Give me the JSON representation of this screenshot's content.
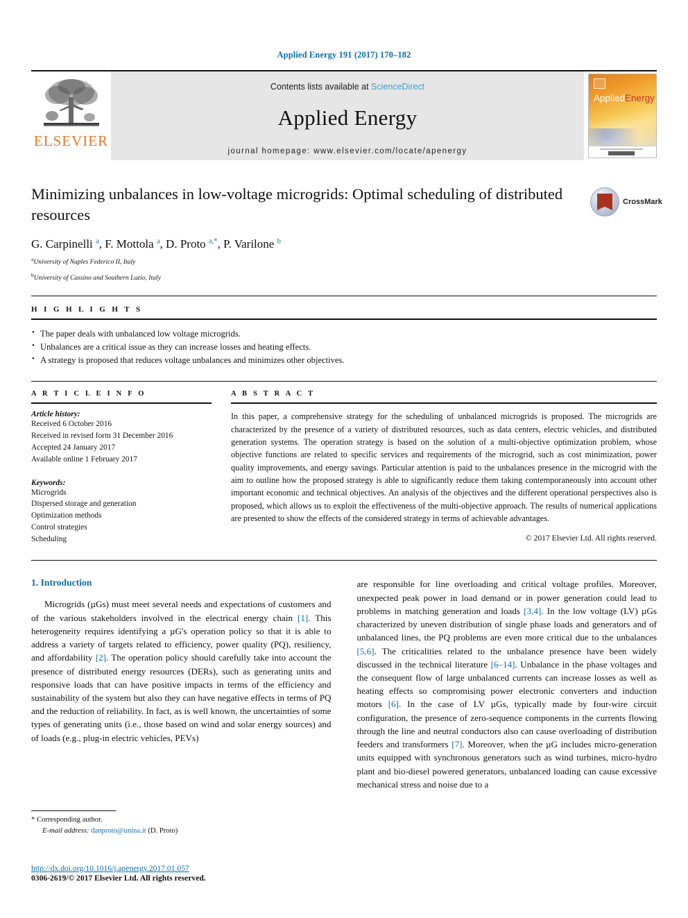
{
  "running_head": "Applied Energy 191 (2017) 170–182",
  "masthead": {
    "publisher_logo_text": "ELSEVIER",
    "contents_prefix": "Contents lists available at ",
    "contents_link": "ScienceDirect",
    "journal_name": "Applied Energy",
    "homepage": "journal homepage: www.elsevier.com/locate/apenergy",
    "cover": {
      "word1": "Applied",
      "word2": "Energy"
    }
  },
  "crossmark": {
    "label": "CrossMark"
  },
  "article": {
    "title": "Minimizing unbalances in low-voltage microgrids: Optimal scheduling of distributed resources",
    "authors_html": "G. Carpinelli <sup>a</sup>, F. Mottola <sup>a</sup>, D. Proto <sup>a,*</sup>, P. Varilone <sup>b</sup>",
    "affiliations": [
      {
        "marker": "a",
        "text": "University of Naples Federico II, Italy"
      },
      {
        "marker": "b",
        "text": "University of Cassino and Southern Lazio, Italy"
      }
    ]
  },
  "highlights": {
    "heading": "H I G H L I G H T S",
    "items": [
      "The paper deals with unbalanced low voltage microgrids.",
      "Unbalances are a critical issue as they can increase losses and heating effects.",
      "A strategy is proposed that reduces voltage unbalances and minimizes other objectives."
    ]
  },
  "article_info": {
    "heading": "A R T I C L E   I N F O",
    "history_label": "Article history:",
    "history": [
      "Received 6 October 2016",
      "Received in revised form 31 December 2016",
      "Accepted 24 January 2017",
      "Available online 1 February 2017"
    ],
    "keywords_label": "Keywords:",
    "keywords": [
      "Microgrids",
      "Dispersed storage and generation",
      "Optimization methods",
      "Control strategies",
      "Scheduling"
    ]
  },
  "abstract": {
    "heading": "A B S T R A C T",
    "text": "In this paper, a comprehensive strategy for the scheduling of unbalanced microgrids is proposed. The microgrids are characterized by the presence of a variety of distributed resources, such as data centers, electric vehicles, and distributed generation systems. The operation strategy is based on the solution of a multi-objective optimization problem, whose objective functions are related to specific services and requirements of the microgrid, such as cost minimization, power quality improvements, and energy savings. Particular attention is paid to the unbalances presence in the microgrid with the aim to outline how the proposed strategy is able to significantly reduce them taking contemporaneously into account other important economic and technical objectives. An analysis of the objectives and the different operational perspectives also is proposed, which allows us to exploit the effectiveness of the multi-objective approach. The results of numerical applications are presented to show the effects of the considered strategy in terms of achievable advantages.",
    "copyright": "© 2017 Elsevier Ltd. All rights reserved."
  },
  "body": {
    "section_number_title": "1. Introduction",
    "left_paragraph_html": "Microgrids (&micro;Gs) must meet several needs and expectations of customers and of the various stakeholders involved in the electrical energy chain <span class=\"cite\">[1]</span>. This heterogeneity requires identifying a &micro;G's operation policy so that it is able to address a variety of targets related to efficiency, power quality (PQ), resiliency, and affordability <span class=\"cite\">[2]</span>. The operation policy should carefully take into account the presence of distributed energy resources (DERs), such as generating units and responsive loads that can have positive impacts in terms of the efficiency and sustainability of the system but also they can have negative effects in terms of PQ and the reduction of reliability. In fact, as is well known, the uncertainties of some types of generating units (i.e., those based on wind and solar energy sources) and of loads (e.g., plug-in electric vehicles, PEVs)",
    "right_paragraph_html": "are responsible for line overloading and critical voltage profiles. Moreover, unexpected peak power in load demand or in power generation could lead to problems in matching generation and loads <span class=\"cite\">[3,4]</span>. In the low voltage (LV) &micro;Gs characterized by uneven distribution of single phase loads and generators and of unbalanced lines, the PQ problems are even more critical due to the unbalances <span class=\"cite\">[5,6]</span>. The criticalities related to the unbalance presence have been widely discussed in the technical literature <span class=\"cite\">[6&ndash;14]</span>. Unbalance in the phase voltages and the consequent flow of large unbalanced currents can increase losses as well as heating effects so compromising power electronic converters and induction motors <span class=\"cite\">[6]</span>. In the case of LV &micro;Gs, typically made by four-wire circuit configuration, the presence of zero-sequence components in the currents flowing through the line and neutral conductors also can cause overloading of distribution feeders and transformers <span class=\"cite\">[7]</span>. Moreover, when the &micro;G includes micro-generation units equipped with synchronous generators such as wind turbines, micro-hydro plant and bio-diesel powered generators, unbalanced loading can cause excessive mechanical stress and noise due to a"
  },
  "footer": {
    "corresponding_marker": "*",
    "corresponding_text": "Corresponding author.",
    "email_label": "E-mail address:",
    "email": "danproto@unina.it",
    "email_person": "(D. Proto)",
    "doi": "http://dx.doi.org/10.1016/j.apenergy.2017.01.057",
    "issn_line": "0306-2619/© 2017 Elsevier Ltd. All rights reserved."
  },
  "colors": {
    "link_blue": "#0b6ea8",
    "elsevier_orange": "#E87722",
    "masthead_grey": "#e6e6e6"
  }
}
